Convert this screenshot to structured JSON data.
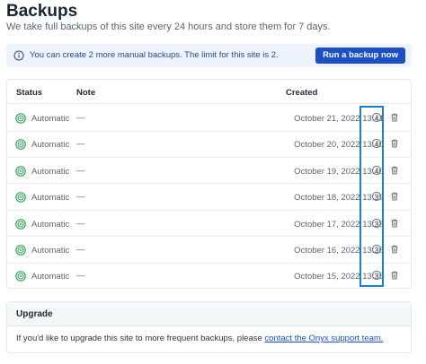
{
  "header": {
    "title": "Backups",
    "subtitle": "We take full backups of this site every 24 hours and store them for 7 days."
  },
  "notice": {
    "text": "You can create 2 more manual backups. The limit for this site is 2.",
    "button_label": "Run a backup now",
    "icon": "info-icon"
  },
  "table": {
    "columns": {
      "status": "Status",
      "note": "Note",
      "created": "Created"
    },
    "rows": [
      {
        "status": "Automatic",
        "note": "—",
        "created": "October 21, 2022 13:41"
      },
      {
        "status": "Automatic",
        "note": "—",
        "created": "October 20, 2022 13:40"
      },
      {
        "status": "Automatic",
        "note": "—",
        "created": "October 19, 2022 13:40"
      },
      {
        "status": "Automatic",
        "note": "—",
        "created": "October 18, 2022 13:39"
      },
      {
        "status": "Automatic",
        "note": "—",
        "created": "October 17, 2022 13:38"
      },
      {
        "status": "Automatic",
        "note": "—",
        "created": "October 16, 2022 13:36"
      },
      {
        "status": "Automatic",
        "note": "—",
        "created": "October 15, 2022 13:35"
      }
    ]
  },
  "upgrade": {
    "title": "Upgrade",
    "text": "If you'd like to upgrade this site to more frequent backups, please ",
    "link_text": "contact the Onyx support team."
  },
  "colors": {
    "accent": "#1b4fc8",
    "status_green": "#2fa35a",
    "highlight": "#1a7fcd",
    "notice_bg": "#eef3fd"
  }
}
